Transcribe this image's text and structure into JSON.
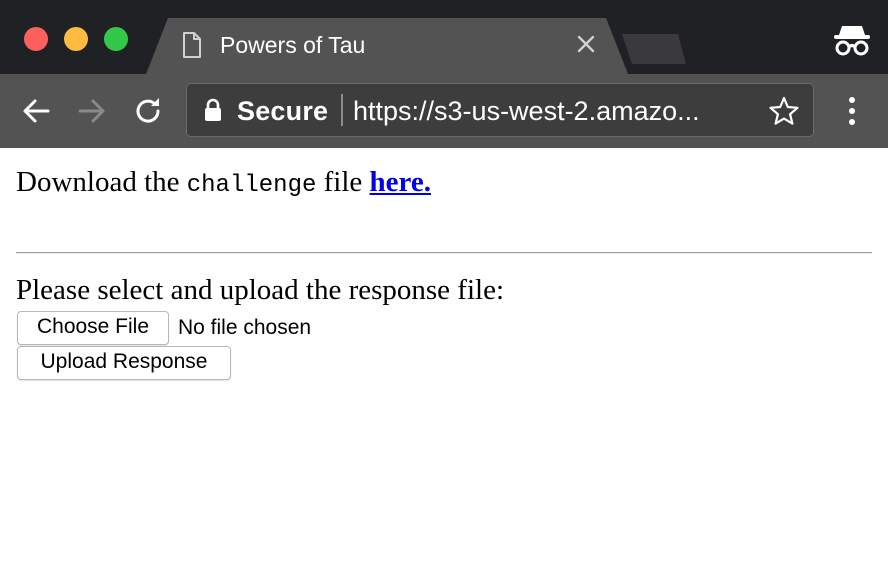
{
  "tab": {
    "title": "Powers of Tau"
  },
  "toolbar": {
    "secure_label": "Secure",
    "url": "https://s3-us-west-2.amazo..."
  },
  "icons": {
    "window_controls": [
      "close",
      "minimize",
      "maximize"
    ],
    "tab_icon": "document-icon",
    "tab_close": "close-icon",
    "incognito": "incognito-icon",
    "back": "back-arrow-icon",
    "forward": "forward-arrow-icon",
    "reload": "reload-icon",
    "lock": "lock-icon",
    "bookmark": "star-icon",
    "menu": "kebab-menu-icon"
  },
  "colors": {
    "link": "#0000ee",
    "traffic_close": "#fc605c",
    "traffic_min": "#fdbc40",
    "traffic_max": "#34c84a",
    "tabstrip_bg": "#202124",
    "toolbar_bg": "#535353"
  },
  "page": {
    "download_prefix": "Download the",
    "download_code": "challenge",
    "download_mid": "file",
    "download_link": "here.",
    "upload_prompt": "Please select and upload the response file:",
    "choose_file_label": "Choose File",
    "file_status": "No file chosen",
    "upload_button_label": "Upload Response"
  }
}
